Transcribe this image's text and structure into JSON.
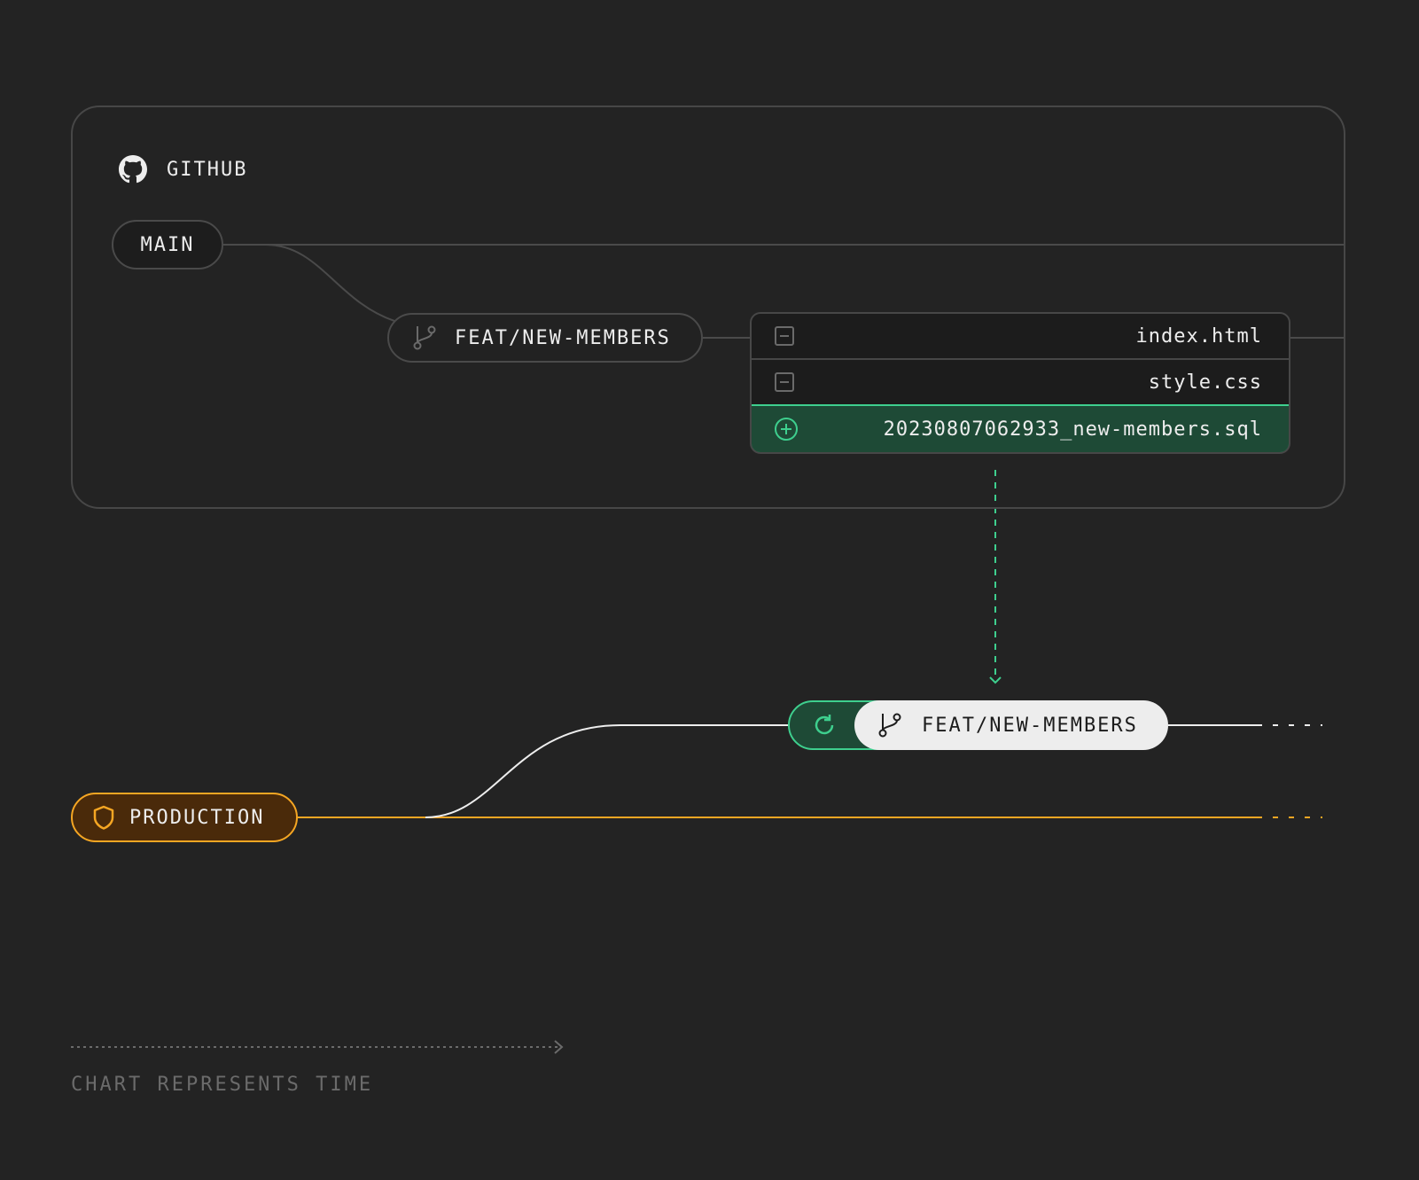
{
  "github": {
    "title": "GITHUB",
    "icon": "github-icon",
    "main_branch": "MAIN",
    "feature_branch": "FEAT/NEW-MEMBERS",
    "files": [
      {
        "name": "index.html",
        "status": "modified"
      },
      {
        "name": "style.css",
        "status": "modified"
      },
      {
        "name": "20230807062933_new-members.sql",
        "status": "added"
      }
    ]
  },
  "deploy": {
    "preview_branch": "FEAT/NEW-MEMBERS",
    "production_label": "PRODUCTION"
  },
  "footer": {
    "time_label": "CHART REPRESENTS TIME"
  },
  "colors": {
    "background": "#232323",
    "accent_green": "#3ecf8e",
    "production_orange": "#f5a623",
    "border": "#474747"
  }
}
